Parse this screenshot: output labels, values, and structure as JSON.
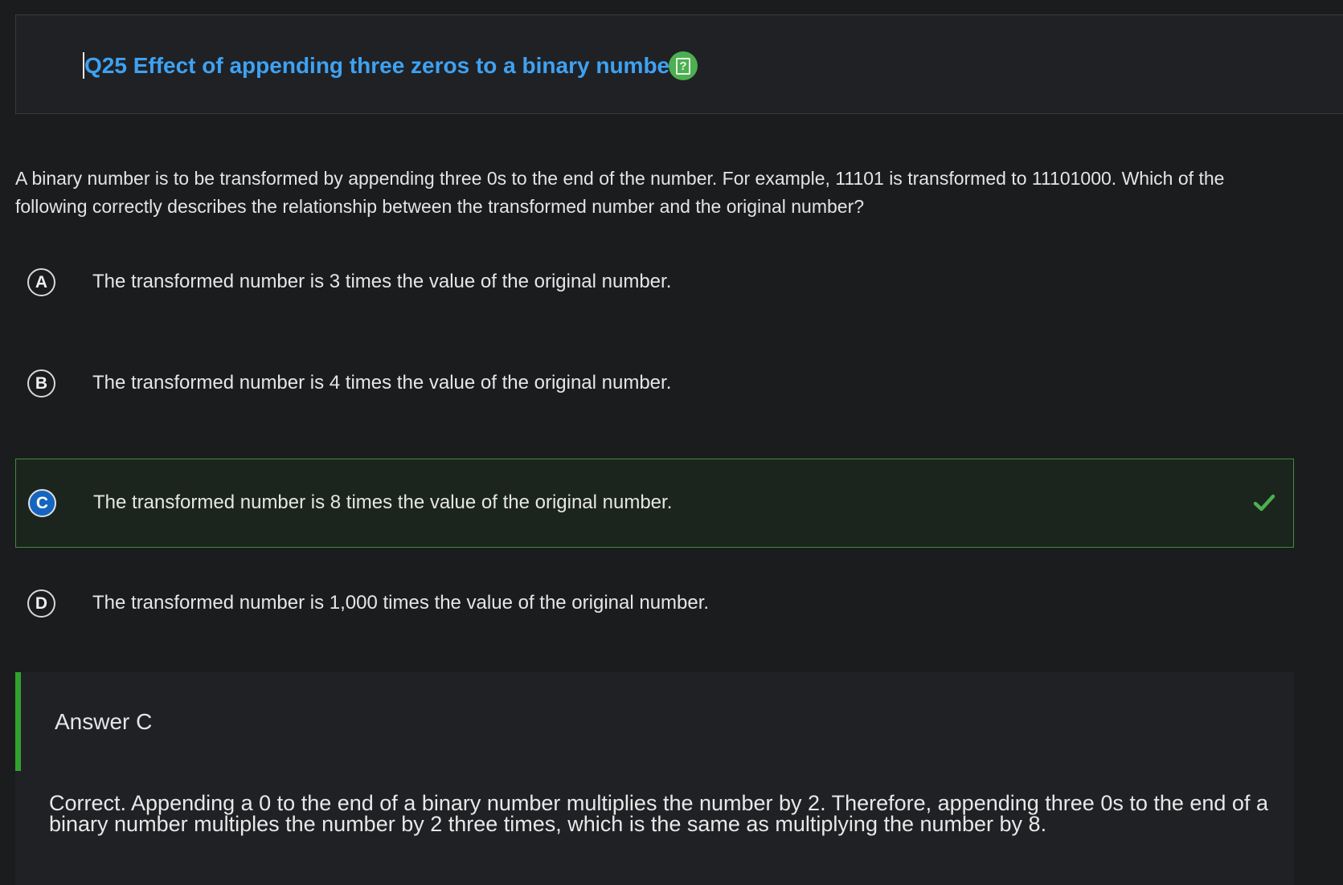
{
  "question_header": {
    "title": "Q25 Effect of appending three zeros to a binary number",
    "help_icon": "question-square-icon",
    "help_glyph": "?"
  },
  "question": {
    "text": "A binary number is to be transformed by appending three 0s to the end of the number. For example, 11101 is transformed to 11101000. Which of the following correctly describes the relationship between the transformed number and the original number?"
  },
  "choices": [
    {
      "letter": "A",
      "text": "The transformed number is 3 times the value of the original number.",
      "selected": false
    },
    {
      "letter": "B",
      "text": "The transformed number is 4 times the value of the original number.",
      "selected": false
    },
    {
      "letter": "C",
      "text": "The transformed number is 8 times the value of the original number.",
      "selected": true,
      "correct": true
    },
    {
      "letter": "D",
      "text": "The transformed number is 1,000 times the value of the original number.",
      "selected": false
    }
  ],
  "answer": {
    "title": "Answer C",
    "explanation": "Correct. Appending a 0 to the end of a binary number multiplies the number by 2. Therefore, appending three 0s to the end of a binary number multiples the number by 2 three times, which is the same as multiplying the number by 8."
  },
  "colors": {
    "background": "#1b1c1e",
    "title": "#3ea2f3",
    "correct_accent": "#31a22e",
    "selected_letter": "#1565c0"
  }
}
